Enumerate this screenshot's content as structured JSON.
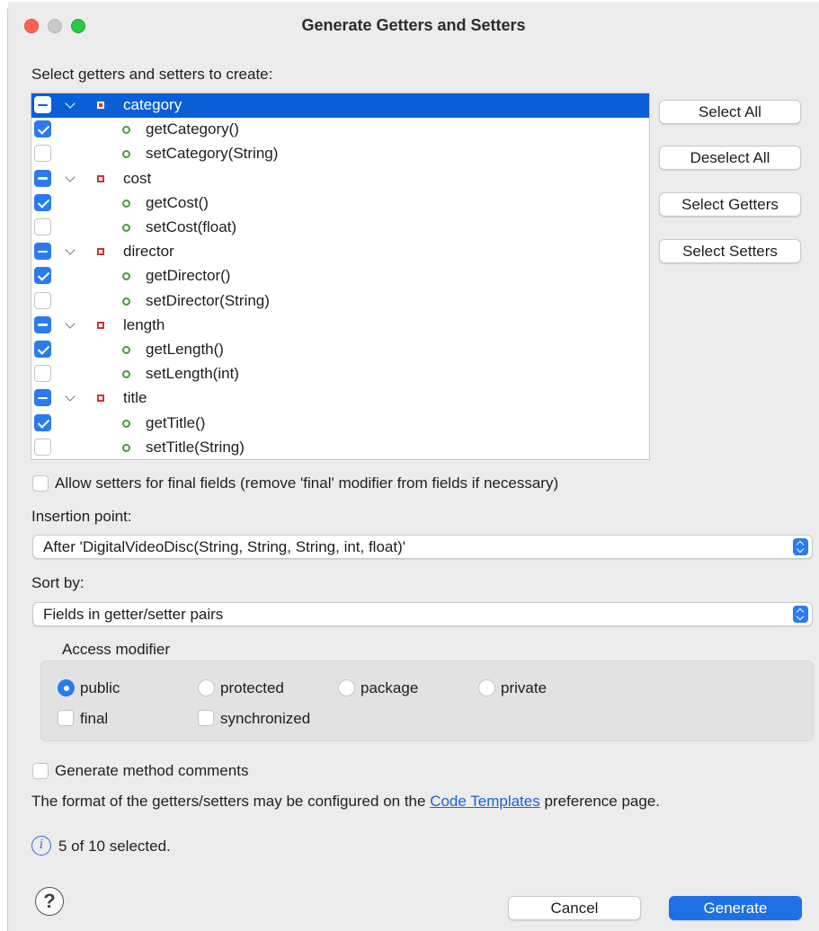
{
  "window": {
    "title": "Generate Getters and Setters"
  },
  "tree_label": "Select getters and setters to create:",
  "tree": {
    "rows": [
      {
        "kind": "field",
        "state": "mixed",
        "text": "category",
        "selected": true
      },
      {
        "kind": "method",
        "state": "checked",
        "text": "getCategory()"
      },
      {
        "kind": "method",
        "state": "unchecked",
        "text": "setCategory(String)"
      },
      {
        "kind": "field",
        "state": "mixed",
        "text": "cost"
      },
      {
        "kind": "method",
        "state": "checked",
        "text": "getCost()"
      },
      {
        "kind": "method",
        "state": "unchecked",
        "text": "setCost(float)"
      },
      {
        "kind": "field",
        "state": "mixed",
        "text": "director"
      },
      {
        "kind": "method",
        "state": "checked",
        "text": "getDirector()"
      },
      {
        "kind": "method",
        "state": "unchecked",
        "text": "setDirector(String)"
      },
      {
        "kind": "field",
        "state": "mixed",
        "text": "length"
      },
      {
        "kind": "method",
        "state": "checked",
        "text": "getLength()"
      },
      {
        "kind": "method",
        "state": "unchecked",
        "text": "setLength(int)"
      },
      {
        "kind": "field",
        "state": "mixed",
        "text": "title"
      },
      {
        "kind": "method",
        "state": "checked",
        "text": "getTitle()"
      },
      {
        "kind": "method",
        "state": "unchecked",
        "text": "setTitle(String)"
      }
    ]
  },
  "side_buttons": {
    "select_all": "Select All",
    "deselect_all": "Deselect All",
    "select_getters": "Select Getters",
    "select_setters": "Select Setters"
  },
  "allow_setters_final": "Allow setters for final fields (remove 'final' modifier from fields if necessary)",
  "insertion_point": {
    "label": "Insertion point:",
    "value": "After 'DigitalVideoDisc(String, String, String, int, float)'"
  },
  "sort_by": {
    "label": "Sort by:",
    "value": "Fields in getter/setter pairs"
  },
  "access_modifier": {
    "label": "Access modifier",
    "public": "public",
    "protected": "protected",
    "package": "package",
    "private": "private",
    "final": "final",
    "synchronized": "synchronized"
  },
  "generate_comments": "Generate method comments",
  "format_note": {
    "before": "The format of the getters/setters may be configured on the ",
    "link": "Code Templates",
    "after": " preference page."
  },
  "status": "5 of 10 selected.",
  "footer": {
    "cancel": "Cancel",
    "generate": "Generate",
    "help": "?"
  },
  "icons": {
    "info": "i",
    "help": "?"
  },
  "colors": {
    "accent": "#1f6fe5",
    "field_icon": "#d0323a",
    "method_icon": "#4a9a3b",
    "selection": "#0a5fd6"
  }
}
